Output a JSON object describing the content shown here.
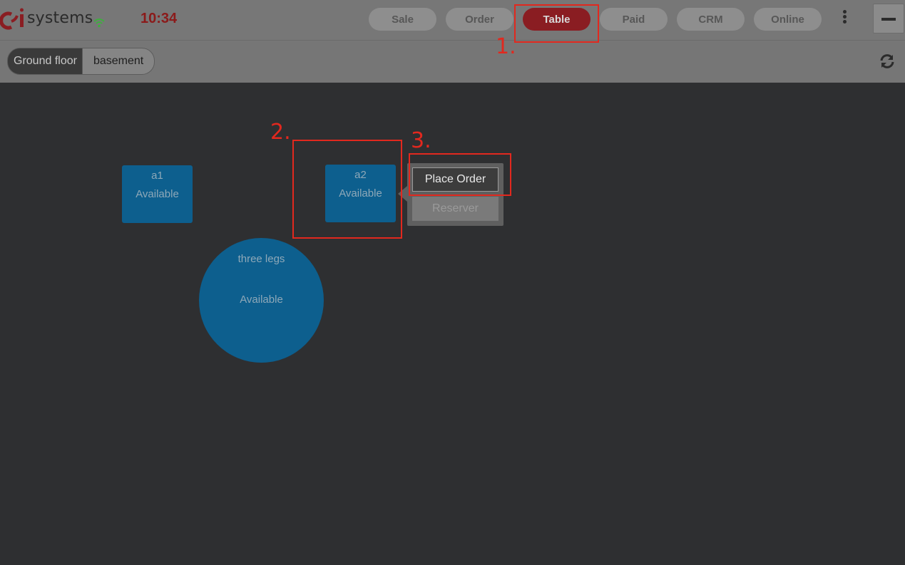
{
  "brand": {
    "logo_text": "systems"
  },
  "clock": "10:34",
  "nav": {
    "items": [
      {
        "label": "Sale",
        "active": false
      },
      {
        "label": "Order",
        "active": false
      },
      {
        "label": "Table",
        "active": true
      },
      {
        "label": "Paid",
        "active": false
      },
      {
        "label": "CRM",
        "active": false
      },
      {
        "label": "Online",
        "active": false
      }
    ],
    "menu_icon": "kebab-menu-icon",
    "minimize_icon": "minimize-icon"
  },
  "floors": {
    "items": [
      {
        "label": "Ground floor",
        "active": true
      },
      {
        "label": "basement",
        "active": false
      }
    ],
    "refresh_icon": "refresh-icon"
  },
  "tables": [
    {
      "name": "a1",
      "status": "Available",
      "shape": "square"
    },
    {
      "name": "a2",
      "status": "Available",
      "shape": "square"
    },
    {
      "name": "three legs",
      "status": "Available",
      "shape": "round"
    }
  ],
  "popover": {
    "place_order": "Place Order",
    "reserve": "Reserver"
  },
  "annotations": [
    "1.",
    "2.",
    "3."
  ],
  "colors": {
    "accent": "#8a1d22",
    "clock": "#8b1a1a",
    "table_fill": "#0d5f8e",
    "annotation": "#e2281e",
    "wifi": "#3fae3f"
  }
}
